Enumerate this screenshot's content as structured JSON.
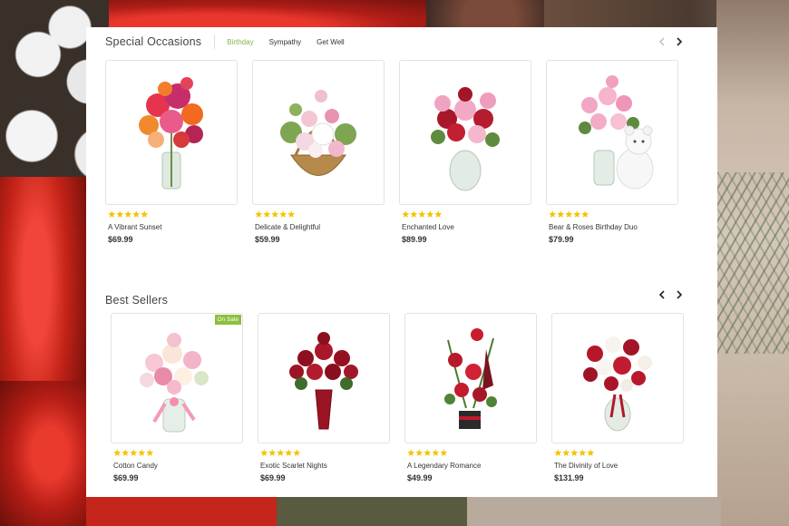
{
  "sections": [
    {
      "title": "Special Occasions",
      "tabs": [
        {
          "label": "Birthday",
          "active": true
        },
        {
          "label": "Sympathy",
          "active": false
        },
        {
          "label": "Get Well",
          "active": false
        }
      ],
      "products": [
        {
          "name": "A Vibrant Sunset",
          "price": "$69.99",
          "rating": 5,
          "badge": "",
          "image": "mixed-bouquet-glass-vase"
        },
        {
          "name": "Delicate & Delightful",
          "price": "$59.99",
          "rating": 5,
          "badge": "",
          "image": "lily-basket-arrangement"
        },
        {
          "name": "Enchanted Love",
          "price": "$89.99",
          "rating": 5,
          "badge": "",
          "image": "red-roses-pink-lilies-vase"
        },
        {
          "name": "Bear & Roses Birthday Duo",
          "price": "$79.99",
          "rating": 5,
          "badge": "",
          "image": "pink-roses-with-teddy-bear"
        }
      ]
    },
    {
      "title": "Best Sellers",
      "tabs": [],
      "products": [
        {
          "name": "Cotton Candy",
          "price": "$69.99",
          "rating": 5,
          "badge": "On Sale",
          "image": "pastel-rose-bouquet-pink-ribbon"
        },
        {
          "name": "Exotic Scarlet Nights",
          "price": "$69.99",
          "rating": 5,
          "badge": "",
          "image": "red-roses-red-vase"
        },
        {
          "name": "A Legendary Romance",
          "price": "$49.99",
          "rating": 5,
          "badge": "",
          "image": "red-roses-modern-arrangement"
        },
        {
          "name": "The Divinity of Love",
          "price": "$131.99",
          "rating": 5,
          "badge": "",
          "image": "red-white-roses-glass-vase"
        }
      ]
    }
  ],
  "colors": {
    "accent_tab": "#86b44a",
    "star": "#f5c400",
    "sale_badge": "#8cbf3f",
    "price_text": "#333333"
  },
  "icons": {
    "prev": "chevron-left-icon",
    "next": "chevron-right-icon",
    "rating": "star-icon"
  }
}
